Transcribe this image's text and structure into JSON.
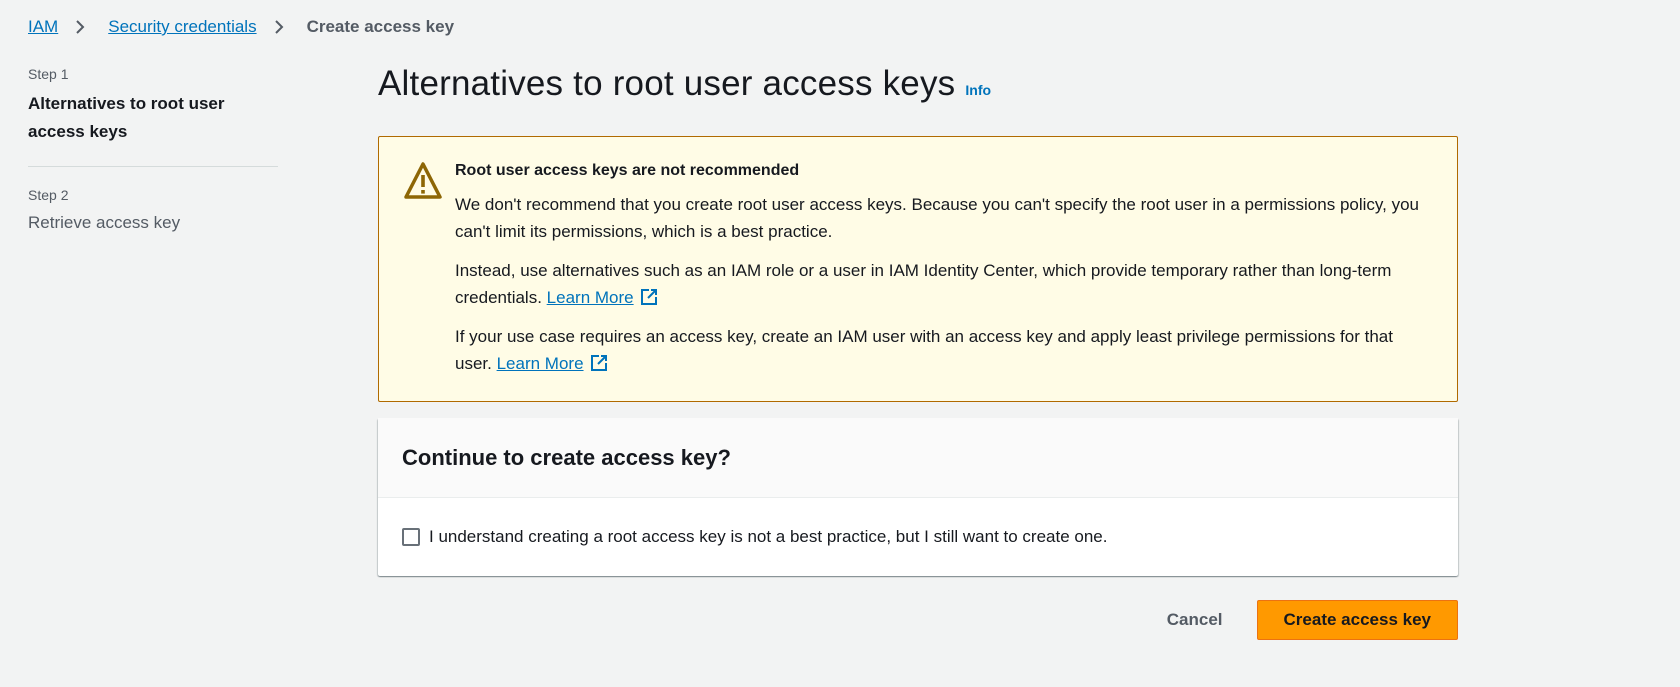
{
  "breadcrumb": {
    "items": [
      "IAM",
      "Security credentials"
    ],
    "current": "Create access key"
  },
  "steps": [
    {
      "label": "Step 1",
      "title": "Alternatives to root user access keys"
    },
    {
      "label": "Step 2",
      "title": "Retrieve access key"
    }
  ],
  "page": {
    "title": "Alternatives to root user access keys",
    "info": "Info"
  },
  "alert": {
    "icon": "warning-icon",
    "title": "Root user access keys are not recommended",
    "p1": "We don't recommend that you create root user access keys. Because you can't specify the root user in a permissions policy, you can't limit its permissions, which is a best practice.",
    "p2": "Instead, use alternatives such as an IAM role or a user in IAM Identity Center, which provide temporary rather than long-term credentials.",
    "p3": "If your use case requires an access key, create an IAM user with an access key and apply least privilege permissions for that user.",
    "learn_more": "Learn More"
  },
  "panel": {
    "title": "Continue to create access key?",
    "checkbox_label": "I understand creating a root access key is not a best practice, but I still want to create one."
  },
  "actions": {
    "cancel": "Cancel",
    "create": "Create access key"
  },
  "colors": {
    "link": "#0073bb",
    "warning_border": "#b06a00",
    "warning_bg": "#fffce6",
    "primary": "#ff9900"
  }
}
